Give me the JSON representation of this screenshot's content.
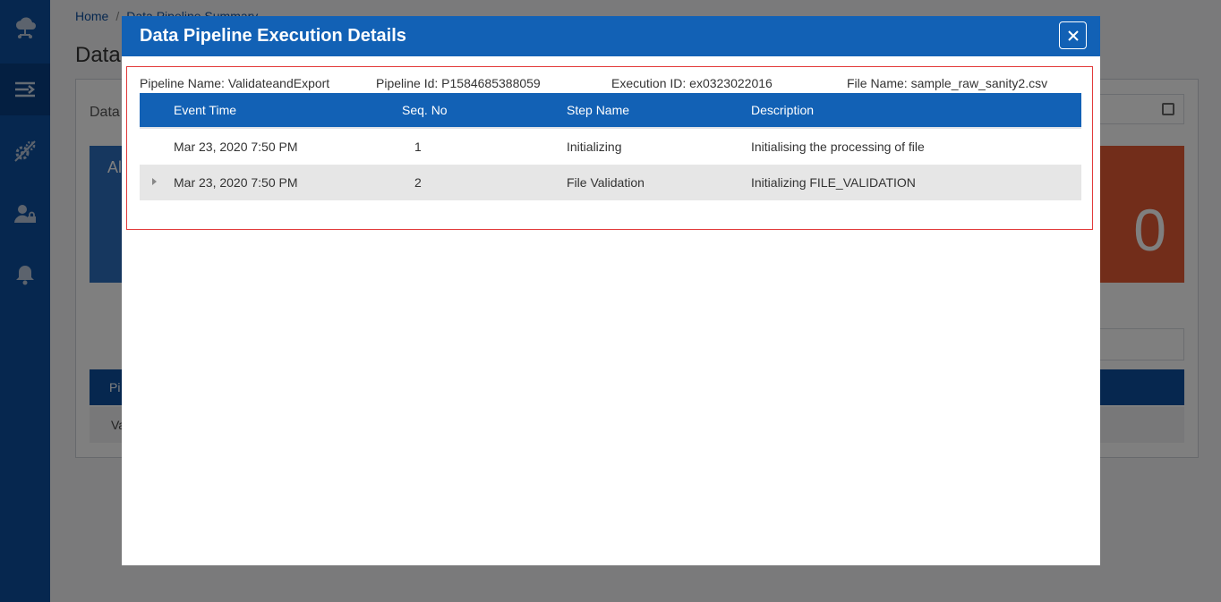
{
  "background": {
    "breadcrumb": {
      "home": "Home",
      "current": "Data Pipeline Summary"
    },
    "page_title": "Data",
    "panel_label": "Data",
    "card_blue_title": "Al",
    "card_red_value": "0",
    "table_header_first": "Pi",
    "table_row_first": "Va"
  },
  "sidebar": {
    "items": [
      {
        "icon": "cloud-network-icon"
      },
      {
        "icon": "pipeline-icon",
        "active": true
      },
      {
        "icon": "settings-icon"
      },
      {
        "icon": "user-lock-icon"
      },
      {
        "icon": "bell-icon"
      }
    ]
  },
  "modal": {
    "title": "Data Pipeline Execution Details",
    "close_icon": "close-icon",
    "meta": {
      "pipeline_name": "Pipeline Name: ValidateandExport",
      "pipeline_id": "Pipeline Id: P1584685388059",
      "execution_id": "Execution ID: ex0323022016",
      "file_name": "File Name: sample_raw_sanity2.csv"
    },
    "columns": [
      "Event Time",
      "Seq. No",
      "Step Name",
      "Description"
    ],
    "rows": [
      {
        "event_time": "Mar 23, 2020 7:50 PM",
        "seq": "1",
        "step": "Initializing",
        "description": "Initialising the processing of file",
        "expandable": false
      },
      {
        "event_time": "Mar 23, 2020 7:50 PM",
        "seq": "2",
        "step": "File Validation",
        "description": "Initializing FILE_VALIDATION",
        "expandable": true
      }
    ]
  },
  "colors": {
    "sidebar": "#0c4f9e",
    "header": "#1261b5",
    "highlight_border": "#e23a3a",
    "card_red": "#e45b35",
    "card_blue": "#2d6fbf"
  }
}
